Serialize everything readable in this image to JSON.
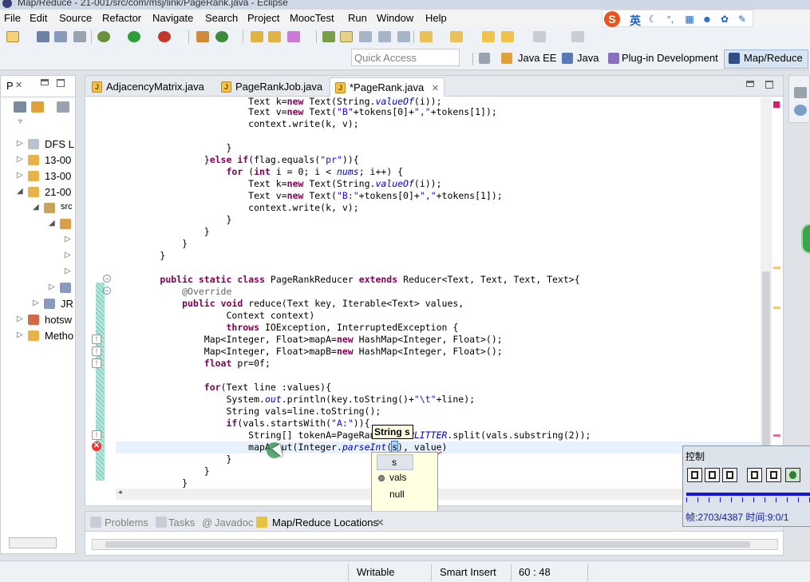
{
  "window": {
    "title": "Map/Reduce - 21-001/src/com/msj/link/PageRank.java - Eclipse"
  },
  "menu": [
    "File",
    "Edit",
    "Source",
    "Refactor",
    "Navigate",
    "Search",
    "Project",
    "MoocTest",
    "Run",
    "Window",
    "Help"
  ],
  "ime": {
    "mode": "英"
  },
  "quick_access": {
    "placeholder": "Quick Access"
  },
  "perspectives": [
    "Java EE",
    "Java",
    "Plug-in Development",
    "Map/Reduce"
  ],
  "left_panel": {
    "tab": "P",
    "items": [
      "DFS L",
      "13-00",
      "13-00",
      "21-00",
      "src",
      "",
      "",
      "",
      "",
      "JR",
      "hotsw",
      "Metho"
    ]
  },
  "editor": {
    "tabs": [
      {
        "label": "AdjacencyMatrix.java"
      },
      {
        "label": "PageRankJob.java"
      },
      {
        "label": "*PageRank.java"
      }
    ],
    "tooltip": "String s",
    "completion": [
      "s",
      "vals",
      "null"
    ]
  },
  "bottom_panel": {
    "tabs": [
      "Problems",
      "Tasks",
      "Javadoc",
      "Map/Reduce Locations"
    ]
  },
  "status": {
    "mode": "Writable",
    "insert": "Smart Insert",
    "position": "60 : 48"
  },
  "control": {
    "title": "控制",
    "info": "帧:2703/4387 时间:9:0/1"
  },
  "colors": {
    "keyword": "#7f0055",
    "string": "#2a00ff",
    "field": "#0000c0",
    "error": "#e02020"
  }
}
